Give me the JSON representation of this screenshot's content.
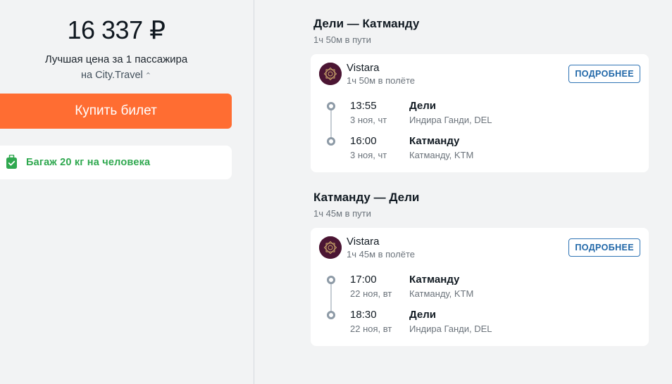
{
  "summary": {
    "price": "16 337 ₽",
    "price_note": "Лучшая цена за 1 пассажира",
    "seller": "на City.Travel",
    "seller_chevron": "⌃⌄",
    "buy_label": "Купить билет",
    "baggage": "Багаж 20 кг на человека",
    "baggage_icon": "luggage-icon",
    "accent_color": "#ff6d32",
    "baggage_color": "#2fa84f"
  },
  "segments": [
    {
      "title": "Дели — Катманду",
      "duration": "1ч 50м в пути",
      "airline": "Vistara",
      "flight_duration": "1ч 50м в полёте",
      "details_label": "ПОДРОБНЕЕ",
      "stops": [
        {
          "time": "13:55",
          "date": "3 ноя, чт",
          "city": "Дели",
          "airport": "Индира Ганди, DEL"
        },
        {
          "time": "16:00",
          "date": "3 ноя, чт",
          "city": "Катманду",
          "airport": "Катманду, KTM"
        }
      ]
    },
    {
      "title": "Катманду — Дели",
      "duration": "1ч 45м в пути",
      "airline": "Vistara",
      "flight_duration": "1ч 45м в полёте",
      "details_label": "ПОДРОБНЕЕ",
      "stops": [
        {
          "time": "17:00",
          "date": "22 ноя, вт",
          "city": "Катманду",
          "airport": "Катманду, KTM"
        },
        {
          "time": "18:30",
          "date": "22 ноя, вт",
          "city": "Дели",
          "airport": "Индира Ганди, DEL"
        }
      ]
    }
  ]
}
